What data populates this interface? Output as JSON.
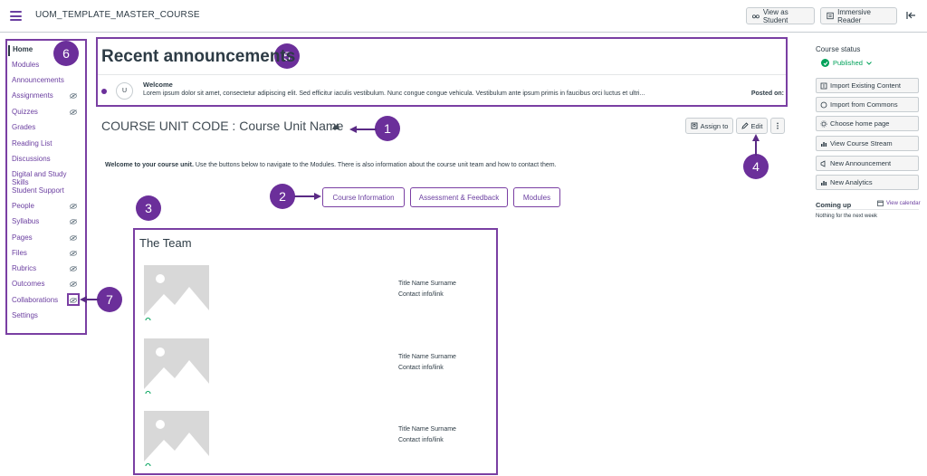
{
  "topbar": {
    "course_title": "UOM_TEMPLATE_MASTER_COURSE",
    "view_as_student": "View as Student",
    "immersive_reader": "Immersive Reader"
  },
  "leftnav": {
    "items": [
      {
        "label": "Home",
        "hidden": false
      },
      {
        "label": "Modules",
        "hidden": false
      },
      {
        "label": "Announcements",
        "hidden": false
      },
      {
        "label": "Assignments",
        "hidden": true
      },
      {
        "label": "Quizzes",
        "hidden": true
      },
      {
        "label": "Grades",
        "hidden": false
      },
      {
        "label": "Reading List",
        "hidden": false
      },
      {
        "label": "Discussions",
        "hidden": false
      },
      {
        "label": "Digital and Study Skills",
        "hidden": false
      },
      {
        "label": "Student Support",
        "hidden": false
      },
      {
        "label": "People",
        "hidden": true
      },
      {
        "label": "Syllabus",
        "hidden": true
      },
      {
        "label": "Pages",
        "hidden": true
      },
      {
        "label": "Files",
        "hidden": true
      },
      {
        "label": "Rubrics",
        "hidden": true
      },
      {
        "label": "Outcomes",
        "hidden": true
      },
      {
        "label": "Collaborations",
        "hidden": true
      },
      {
        "label": "Settings",
        "hidden": false
      }
    ]
  },
  "annotations": [
    "1",
    "2",
    "3",
    "4",
    "5",
    "6",
    "7"
  ],
  "announcements": {
    "title": "Recent announcements",
    "avatar_initial": "U",
    "item_title": "Welcome",
    "item_body": "Lorem ipsum dolor sit amet, consectetur adipiscing elit. Sed efficitur iaculis vestibulum. Nunc congue congue vehicula. Vestibulum ante ipsum primis in faucibus orci luctus et ultri...",
    "posted_on": "Posted on:"
  },
  "course": {
    "heading": "COURSE UNIT CODE : Course Unit Name",
    "assign_to": "Assign to",
    "edit": "Edit",
    "welcome_bold": "Welcome to your course unit.",
    "welcome_rest": " Use the buttons below to navigate to the Modules. There is also information about the course unit team and how to contact them.",
    "buttons": [
      "Course Information",
      "Assessment & Feedback",
      "Modules"
    ]
  },
  "team": {
    "title": "The Team",
    "members": [
      {
        "name": "Title Name Surname",
        "contact": "Contact info/link"
      },
      {
        "name": "Title Name Surname",
        "contact": "Contact info/link"
      },
      {
        "name": "Title Name Surname",
        "contact": "Contact info/link"
      }
    ]
  },
  "sidebar": {
    "course_status": "Course status",
    "published": "Published",
    "buttons": [
      "Import Existing Content",
      "Import from Commons",
      "Choose home page",
      "View Course Stream",
      "New Announcement",
      "New Analytics"
    ],
    "coming_up": "Coming up",
    "view_calendar": "View calendar",
    "nothing": "Nothing for the next week"
  },
  "colors": {
    "accent": "#6b3fa0",
    "annotation": "#6b2f9a",
    "published": "#00a25a"
  }
}
